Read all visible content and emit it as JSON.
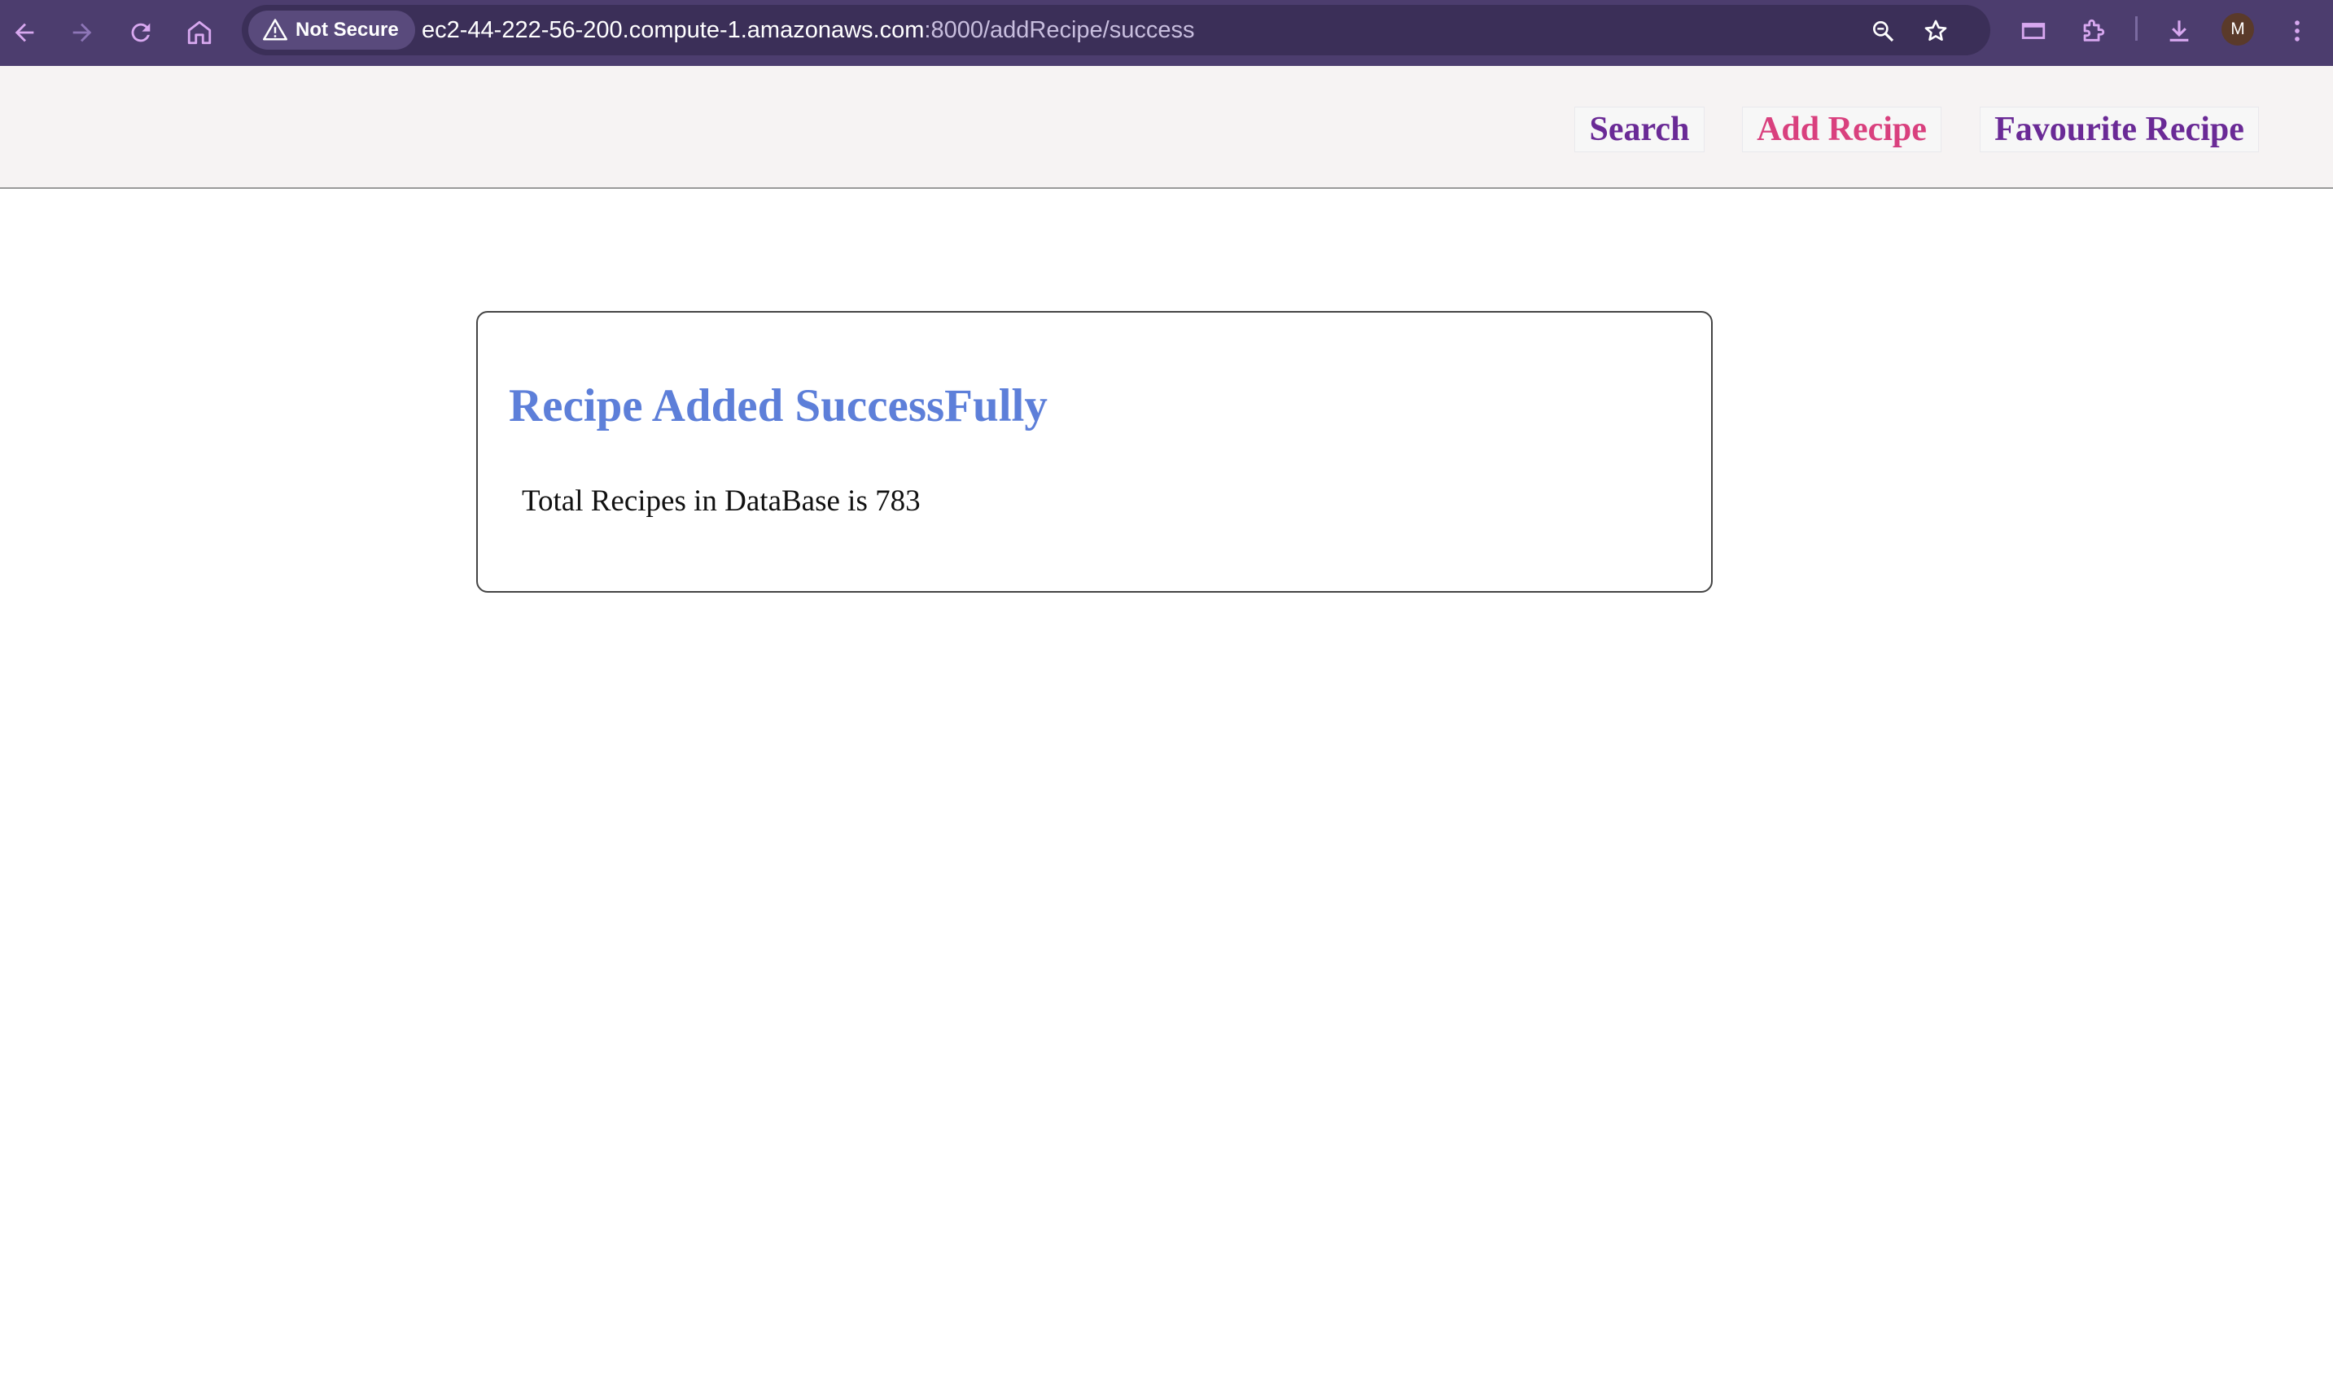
{
  "browser": {
    "security_label": "Not Secure",
    "url_host": "ec2-44-222-56-200.compute-1.amazonaws.com",
    "url_path": ":8000/addRecipe/success",
    "profile_initial": "M",
    "icons": [
      "back-arrow-icon",
      "forward-arrow-icon",
      "reload-icon",
      "home-icon",
      "warning-icon",
      "zoom-icon",
      "bookmark-star-icon",
      "tab-search-icon",
      "extensions-puzzle-icon",
      "download-icon",
      "kebab-menu-icon"
    ],
    "colors": {
      "frame": "#4c3d6e",
      "omnibox": "#3b2f58"
    }
  },
  "header": {
    "nav": {
      "search": "Search",
      "add_recipe": "Add Recipe",
      "favourite_recipe": "Favourite Recipe"
    },
    "colors": {
      "background": "#f6f3f3",
      "link": "#6a2a96",
      "active_link": "#d9407e"
    }
  },
  "main": {
    "title": "Recipe Added SuccessFully",
    "message": "Total Recipes in DataBase is 783",
    "colors": {
      "title": "#5d7fd9"
    }
  }
}
